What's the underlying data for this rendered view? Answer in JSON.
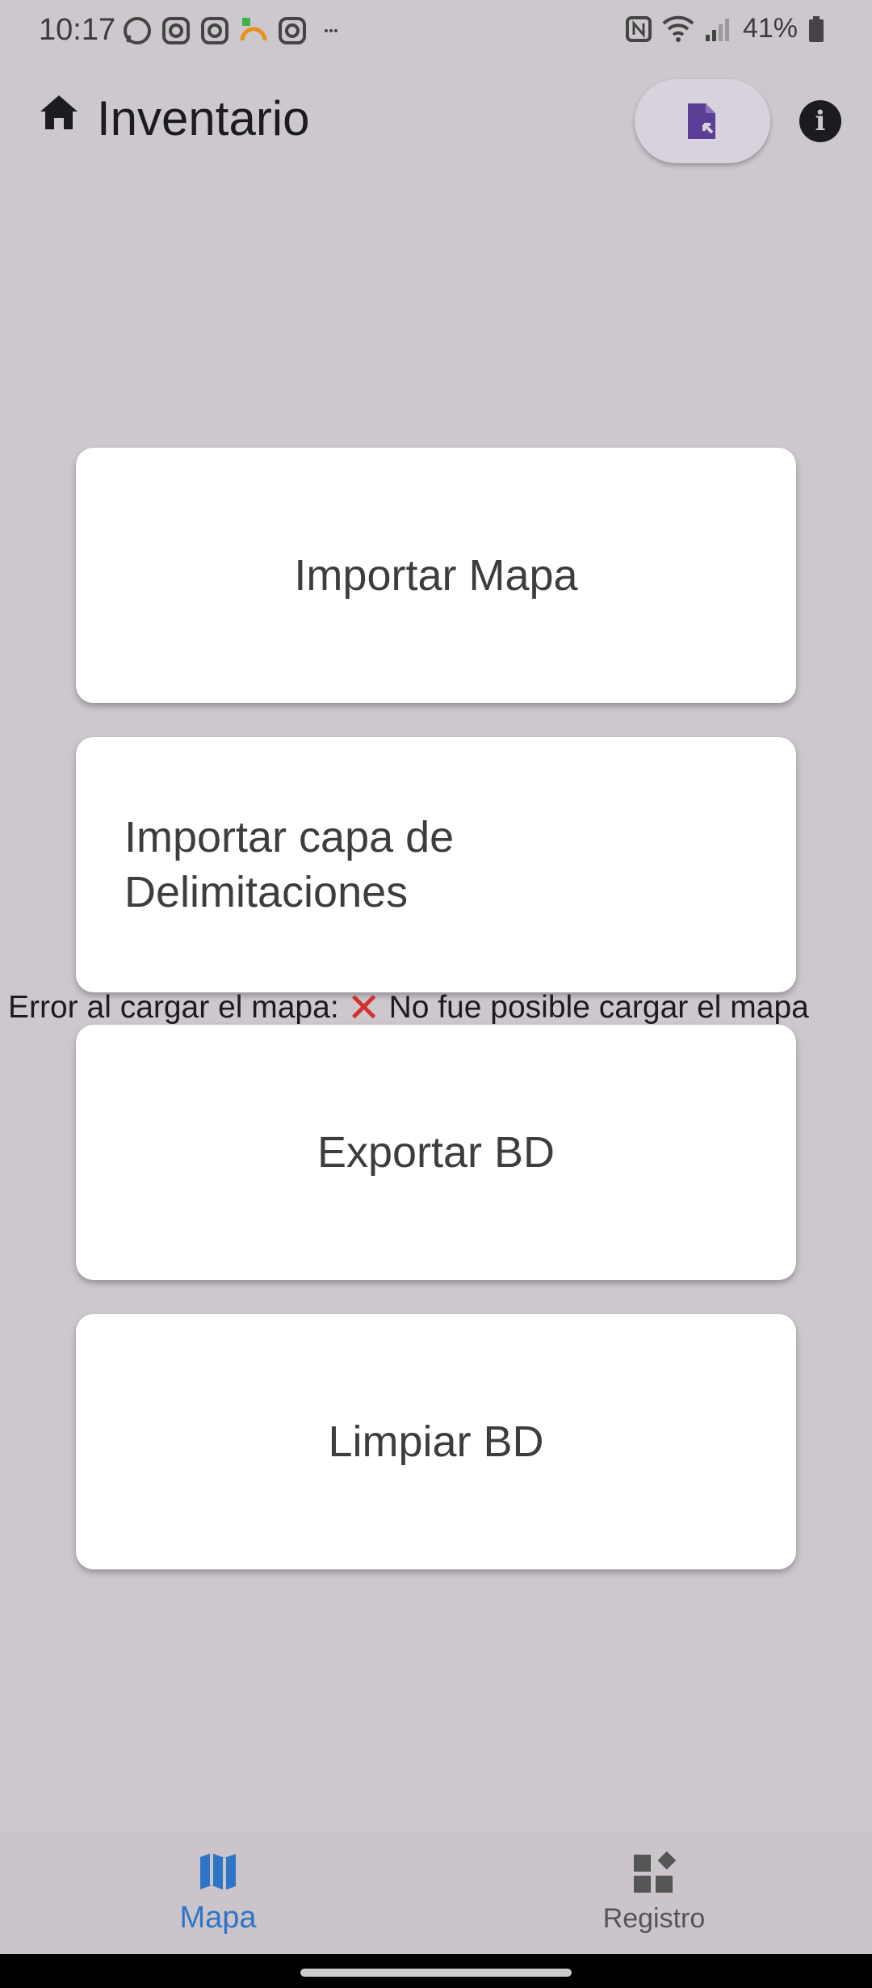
{
  "status_bar": {
    "time": "10:17",
    "battery": "41%"
  },
  "app_bar": {
    "title": "Inventario"
  },
  "cards": {
    "import_map": "Importar Mapa",
    "import_layer_line1": "Importar capa de",
    "import_layer_line2": "Delimitaciones",
    "export_db": "Exportar BD",
    "clear_db": "Limpiar BD"
  },
  "error": {
    "prefix": "Error al cargar el mapa:",
    "message": "No fue posible cargar el mapa"
  },
  "bottom_nav": {
    "items": [
      {
        "label": "Mapa",
        "icon": "map-icon",
        "selected": true
      },
      {
        "label": "Registro",
        "icon": "widgets-icon",
        "selected": false
      }
    ]
  },
  "colors": {
    "background": "#cdc8ce",
    "accent": "#2f75c6",
    "fab_icon": "#5b3e96",
    "error_mark": "#d22f2f"
  }
}
